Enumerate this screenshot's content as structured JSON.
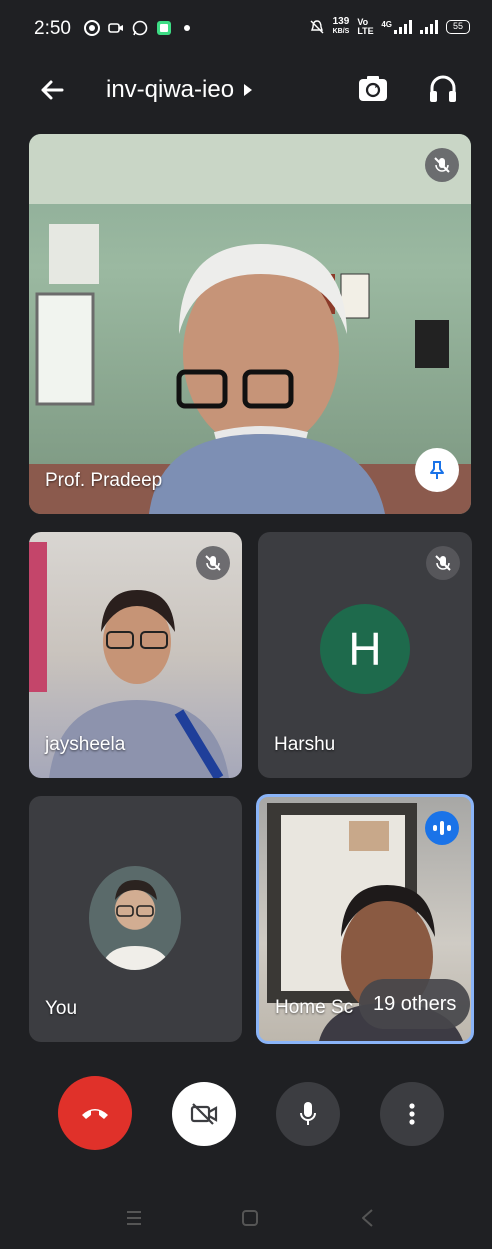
{
  "status_bar": {
    "time": "2:50",
    "speed_value": "139",
    "speed_unit": "KB/S",
    "volte": "Vo LTE",
    "network": "4G",
    "battery": "55"
  },
  "top_bar": {
    "meeting_code": "inv-qiwa-ieo"
  },
  "tiles": {
    "main": {
      "name": "Prof. Pradeep"
    },
    "jaysheela": {
      "name": "jaysheela"
    },
    "harshu": {
      "name": "Harshu",
      "initial": "H"
    },
    "you": {
      "name": "You"
    },
    "home": {
      "name": "Home Sc",
      "others_label": "19 others"
    }
  },
  "colors": {
    "background": "#1f2023",
    "tile": "#3c3d41",
    "end_call": "#e0312a",
    "speaking_accent": "#1a73e8",
    "active_border": "#8ab4f8",
    "avatar_h": "#1e6a4c"
  },
  "icons": {
    "back": "arrow-left-icon",
    "switch_camera": "switch-camera-icon",
    "audio": "headphones-icon",
    "mic_off": "mic-off-icon",
    "pin": "pin-icon",
    "speaking": "audio-level-icon",
    "end_call": "phone-hangup-icon",
    "camera_off": "video-off-icon",
    "mic": "mic-icon",
    "more": "more-vert-icon"
  }
}
